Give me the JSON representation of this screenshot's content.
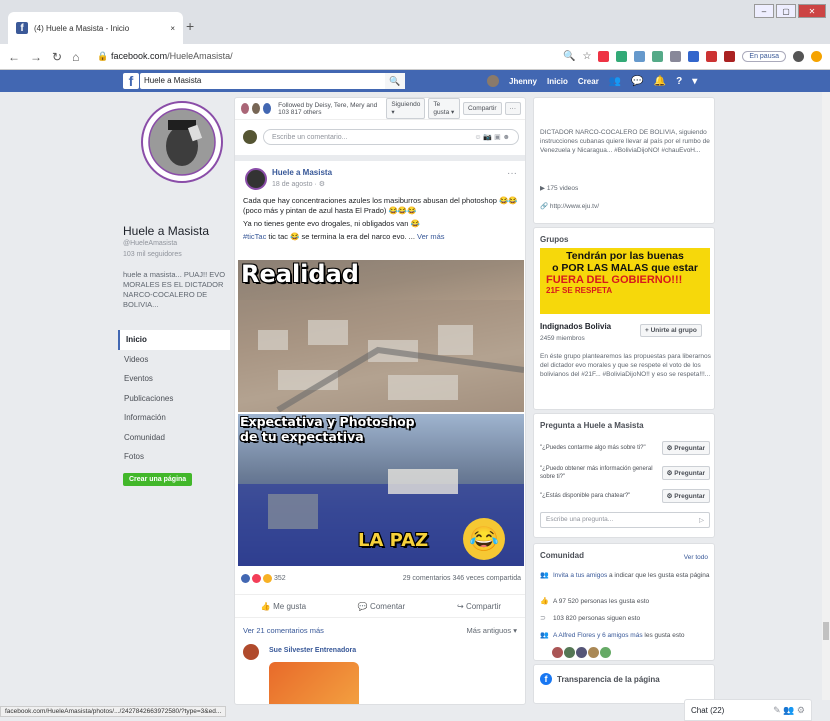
{
  "browser": {
    "tab_title": "(4) Huele a Masista - Inicio",
    "tab_close": "×",
    "new_tab": "+",
    "url_host": "facebook.com",
    "url_path": "/HueleAmasista/",
    "pause_label": "En pausa"
  },
  "fb_header": {
    "logo": "f",
    "search_value": "Huele a Masista",
    "user_name": "Jhenny",
    "nav_home": "Inicio",
    "nav_create": "Crear"
  },
  "profile": {
    "name": "Huele a Masista",
    "handle": "@HueleAmasista",
    "followers": "103 mil seguidores",
    "bio": "huele a masista... PUAJ!! EVO MORALES ES EL DICTADOR NARCO-COCALERO DE BOLIVIA...",
    "nav": [
      "Inicio",
      "Videos",
      "Eventos",
      "Publicaciones",
      "Información",
      "Comunidad",
      "Fotos"
    ],
    "create_page": "Crear una página"
  },
  "feed": {
    "followed_by": "Followed by Deisy, Tere, Mery and 103 817 others",
    "following_btn": "Siguiendo ▾",
    "like_btn": "Te gusta ▾",
    "share_btn": "Compartir",
    "more_btn": "···",
    "comment_placeholder": "Escribe un comentario...",
    "post": {
      "author": "Huele a Masista",
      "date": "18 de agosto · ⚙",
      "text_line1": "Cada que hay concentraciones azules los masiburros abusan del photoshop 😂😂 (poco más y pintan de azul hasta El Prado) 😂😂😂",
      "text_line2": "Ya no tienes gente evo drogales, ni obligados van 😂",
      "hashtag": "#ticTac",
      "text_line3": " tic tac 😂 se termina la era del narco evo. ...",
      "see_more": "Ver más",
      "meme_top": "Realidad",
      "meme_mid1": "Expectativa y Photoshop",
      "meme_mid2": "de tu expectativa",
      "meme_bottom": "LA PAZ",
      "reactions_count": "352",
      "comments_shares": "29 comentarios  346 veces compartida",
      "action_like": "Me gusta",
      "action_comment": "Comentar",
      "action_share": "Compartir",
      "more_comments": "Ver 21 comentarios más",
      "older": "Más antiguos ▾",
      "commenter": "Sue Silvester Entrenadora"
    }
  },
  "right": {
    "about_text": "DICTADOR NARCO-COCALERO DE BOLIVIA, siguiendo instrucciones cubanas quiere llevar al país por el rumbo de Venezuela y Nicaragua... #BoliviaDijoNO! #chauEvoH...",
    "videos": "175 videos",
    "website": "http://www.eju.tv/",
    "groups_title": "Grupos",
    "group_banner1": "Tendrán por las buenas",
    "group_banner2": "o POR LAS MALAS que estar",
    "group_banner3": "FUERA DEL GOBIERNO!!!",
    "group_banner4": "21F SE RESPETA",
    "group_name": "Indignados Bolivia",
    "group_members": "2459 miembros",
    "join_btn": "+ Unirte al grupo",
    "group_desc": "En éste grupo plantearemos las propuestas para liberarnos del dictador evo morales y que se respete el voto de los bolivianos del #21F... #BoliviaDijoNO!! y eso se respeta!!!...",
    "ask_title": "Pregunta a Huele a Masista",
    "questions": [
      "\"¿Puedes contarme algo más sobre ti?\"",
      "\"¿Puedo obtener más información general sobre ti?\"",
      "\"¿Estás disponible para chatear?\""
    ],
    "ask_btn": "Preguntar",
    "ask_placeholder": "Escribe una pregunta...",
    "community_title": "Comunidad",
    "see_all": "Ver todo",
    "community_invite": "Invita a tus amigos",
    "community_invite_rest": " a indicar que les gusta esta página",
    "community_likes": "A 97 520 personas les gusta esto",
    "community_follows": "103 820 personas siguen esto",
    "community_friends_link": "A Alfred Flores y 6 amigos más",
    "community_friends_rest": " les gusta esto",
    "transparency_title": "Transparencia de la página",
    "chat_label": "Chat (22)"
  },
  "status_url": "facebook.com/HueleAmasista/photos/.../2427842663972580/?type=3&ed...",
  "colors": {
    "fb_blue": "#4267b2",
    "link_blue": "#385898",
    "green": "#42b72a"
  }
}
